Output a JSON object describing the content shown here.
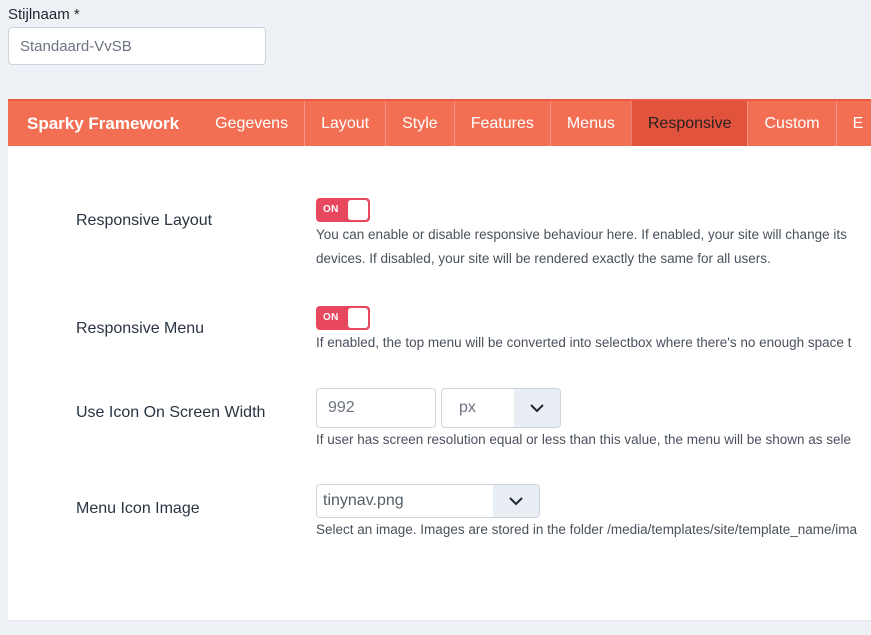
{
  "style_name": {
    "label": "Stijlnaam *",
    "value": "Standaard-VvSB"
  },
  "framework": {
    "brand": "Sparky Framework",
    "tabs": [
      {
        "label": "Gegevens",
        "active": false
      },
      {
        "label": "Layout",
        "active": false
      },
      {
        "label": "Style",
        "active": false
      },
      {
        "label": "Features",
        "active": false
      },
      {
        "label": "Menus",
        "active": false
      },
      {
        "label": "Responsive",
        "active": true
      },
      {
        "label": "Custom",
        "active": false
      },
      {
        "label": "E",
        "active": false
      }
    ]
  },
  "responsive": {
    "responsive_layout": {
      "label": "Responsive Layout",
      "toggle": "ON",
      "help_line1": "You can enable or disable responsive behaviour here. If enabled, your site will change its",
      "help_line2": "devices. If disabled, your site will be rendered exactly the same for all users."
    },
    "responsive_menu": {
      "label": "Responsive Menu",
      "toggle": "ON",
      "help": "If enabled, the top menu will be converted into selectbox where there's no enough space t"
    },
    "icon_width": {
      "label": "Use Icon On Screen Width",
      "value": "992",
      "unit": "px",
      "help": "If user has screen resolution equal or less than this value, the menu will be shown as sele"
    },
    "menu_icon": {
      "label": "Menu Icon Image",
      "value": "tinynav.png",
      "help": "Select an image. Images are stored in the folder /media/templates/site/template_name/ima"
    }
  },
  "colors": {
    "tabbar": "#f36f54",
    "tab_active": "#e2533d",
    "toggle_on": "#e8485e",
    "page_bg": "#eef2f7"
  }
}
